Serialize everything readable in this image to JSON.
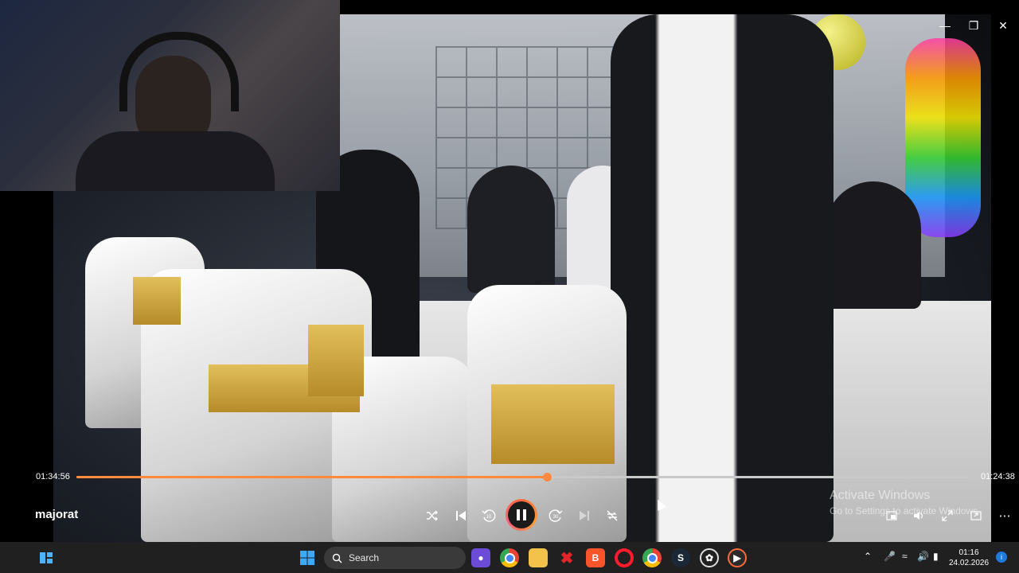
{
  "player": {
    "title": "majorat",
    "current_time": "01:34:56",
    "duration": "01:24:38",
    "progress": 0.527,
    "accent": "#ff8a3d"
  },
  "window_controls": {
    "minimize_icon": "minimize-icon",
    "maximize_icon": "maximize-icon",
    "close_icon": "close-icon"
  },
  "controls": {
    "shuffle_icon": "shuffle-icon",
    "previous_icon": "previous-icon",
    "rewind_label": "10",
    "forward_label": "30",
    "next_icon": "next-icon",
    "repeat_icon": "repeat-off-icon",
    "state": "playing"
  },
  "watermark": {
    "line1": "Activate Windows",
    "line2": "Go to Settings to activate Windows."
  },
  "taskbar": {
    "search_placeholder": "Search",
    "time": "01:16",
    "date": "24.02.2026",
    "apps": [
      "start",
      "widgets",
      "chrome",
      "file-explorer",
      "xbox-game-bar",
      "brave",
      "opera",
      "chrome",
      "steam",
      "chatgpt",
      "media-player"
    ]
  }
}
